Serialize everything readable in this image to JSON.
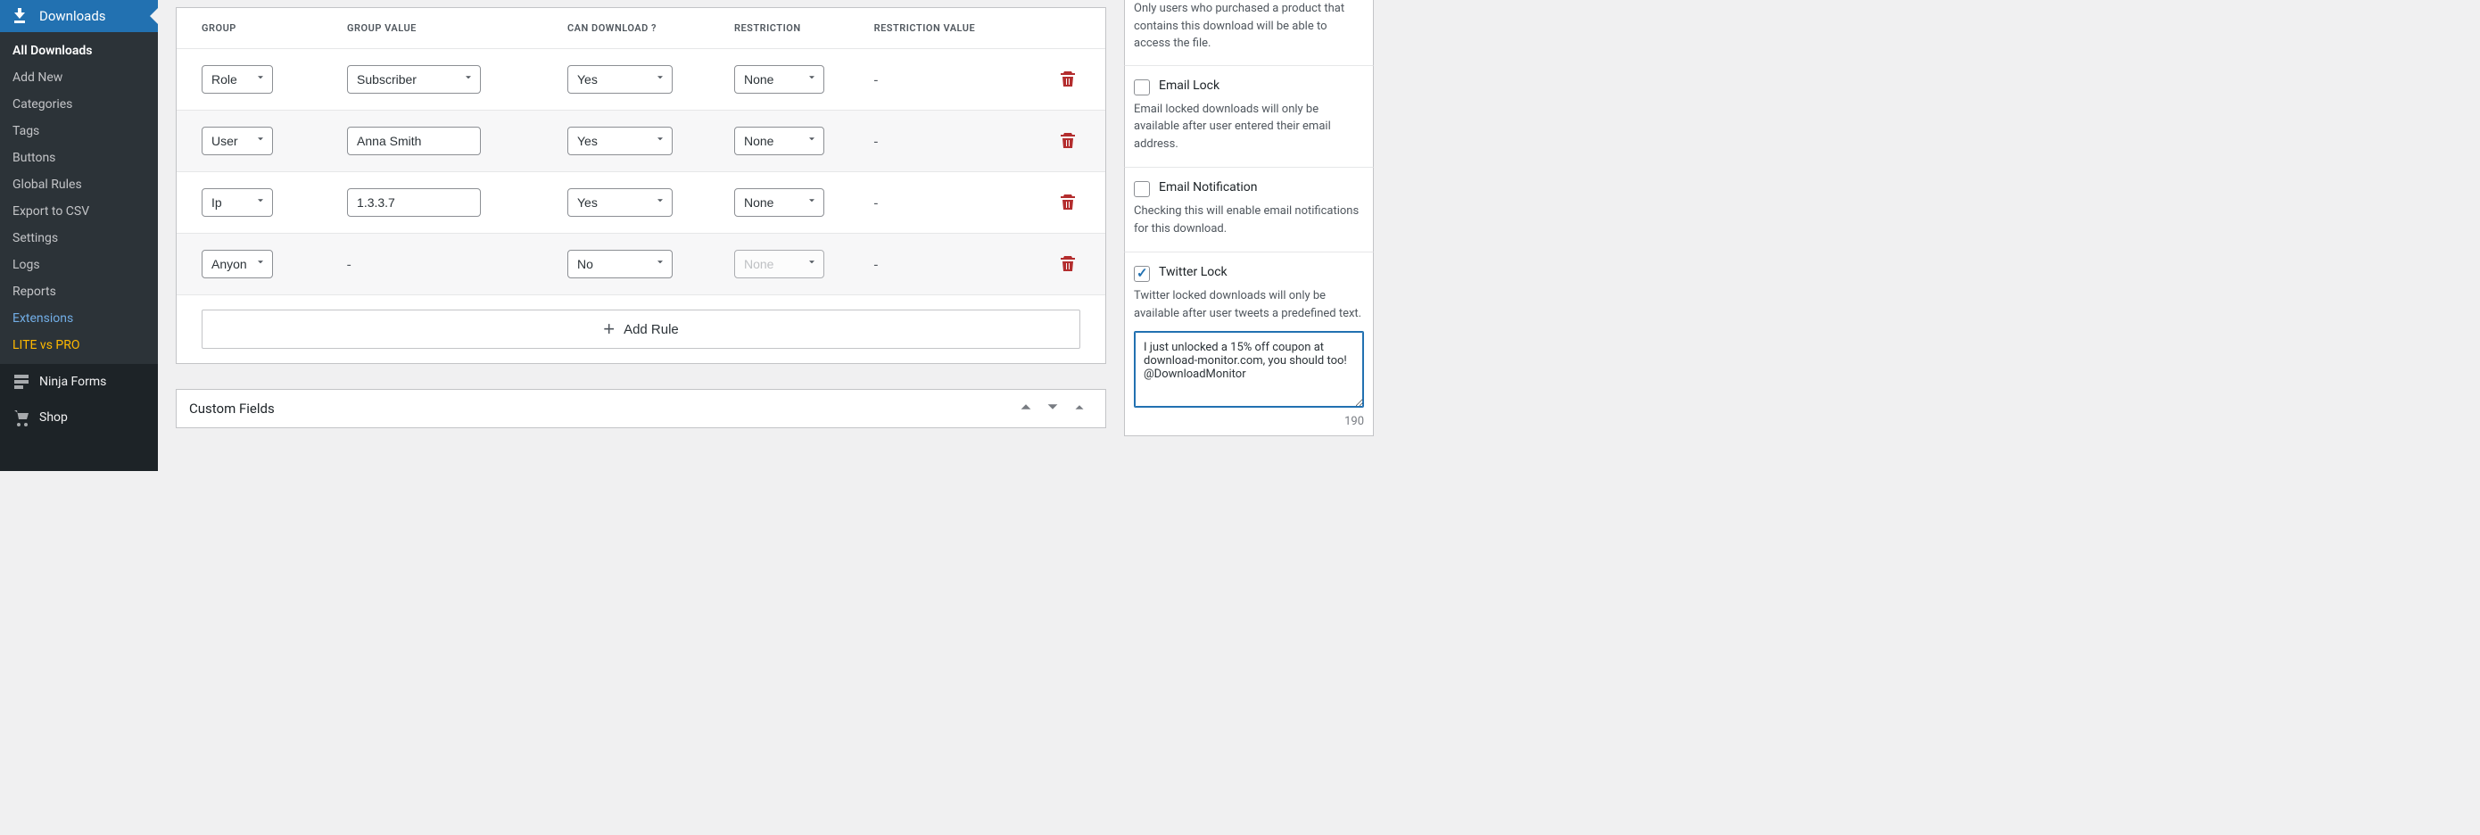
{
  "sidebar": {
    "top_label": "Downloads",
    "submenu": [
      {
        "label": "All Downloads",
        "active": true
      },
      {
        "label": "Add New"
      },
      {
        "label": "Categories"
      },
      {
        "label": "Tags"
      },
      {
        "label": "Buttons"
      },
      {
        "label": "Global Rules"
      },
      {
        "label": "Export to CSV"
      },
      {
        "label": "Settings"
      },
      {
        "label": "Logs"
      },
      {
        "label": "Reports"
      },
      {
        "label": "Extensions",
        "style": "blue"
      },
      {
        "label": "LITE vs PRO",
        "style": "highlight"
      }
    ],
    "other": [
      {
        "label": "Ninja Forms",
        "icon": "form"
      },
      {
        "label": "Shop",
        "icon": "cart"
      }
    ]
  },
  "rules": {
    "headers": {
      "group": "GROUP",
      "group_value": "GROUP VALUE",
      "can_download": "CAN DOWNLOAD ?",
      "restriction": "RESTRICTION",
      "restriction_value": "RESTRICTION VALUE"
    },
    "rows": [
      {
        "group": "Role",
        "group_value_select": "Subscriber",
        "can_download": "Yes",
        "restriction": "None",
        "restriction_value": "-"
      },
      {
        "group": "User",
        "group_value_text": "Anna Smith",
        "can_download": "Yes",
        "restriction": "None",
        "restriction_value": "-",
        "alt": true
      },
      {
        "group": "Ip",
        "group_value_text": "1.3.3.7",
        "can_download": "Yes",
        "restriction": "None",
        "restriction_value": "-"
      },
      {
        "group": "Anyone",
        "group_value_dash": "-",
        "can_download": "No",
        "restriction": "None",
        "restriction_disabled": true,
        "restriction_value": "-",
        "alt": true
      }
    ],
    "add_rule_label": "Add Rule"
  },
  "custom_fields_panel": {
    "title": "Custom Fields"
  },
  "right": {
    "members_only_desc": "Only users who purchased a product that contains this download will be able to access the file.",
    "email_lock": {
      "label": "Email Lock",
      "desc": "Email locked downloads will only be available after user entered their email address.",
      "checked": false
    },
    "email_notification": {
      "label": "Email Notification",
      "desc": "Checking this will enable email notifications for this download.",
      "checked": false
    },
    "twitter_lock": {
      "label": "Twitter Lock",
      "desc": "Twitter locked downloads will only be available after user tweets a predefined text.",
      "checked": true,
      "tweet_text": "I just unlocked a 15% off coupon at download-monitor.com, you should too! @DownloadMonitor",
      "char_count": "190"
    }
  }
}
